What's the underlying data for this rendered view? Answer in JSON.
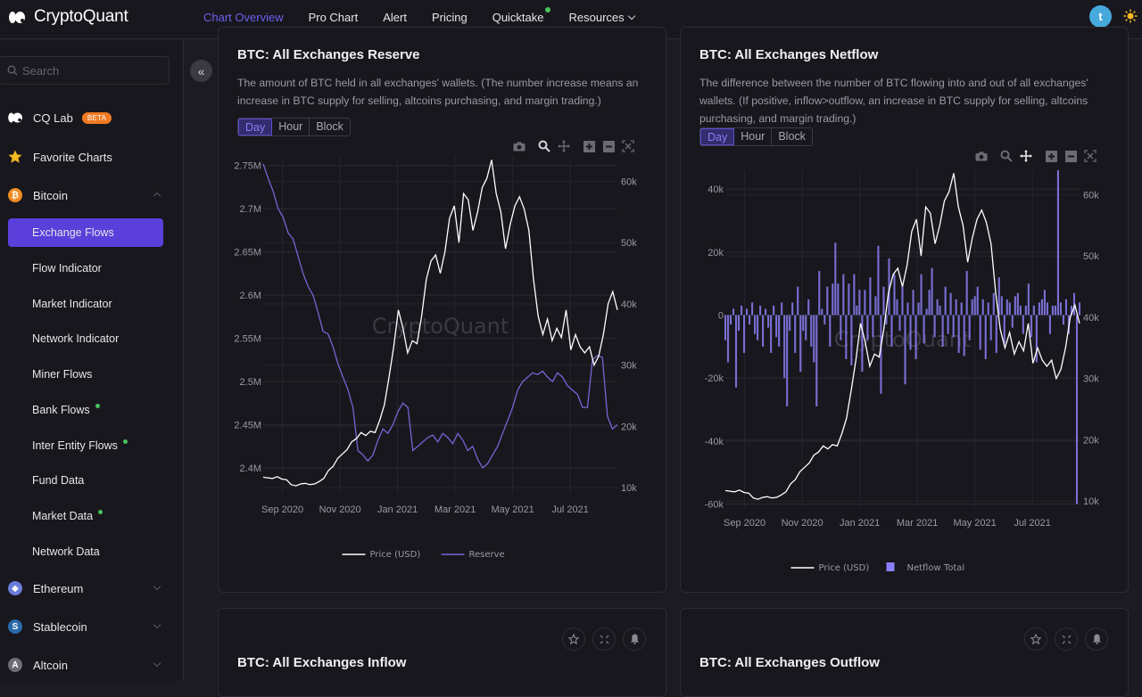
{
  "app": {
    "name": "CryptoQuant"
  },
  "nav": {
    "items": [
      {
        "label": "Chart Overview",
        "active": true
      },
      {
        "label": "Pro Chart"
      },
      {
        "label": "Alert"
      },
      {
        "label": "Pricing"
      },
      {
        "label": "Quicktake",
        "dot": true
      },
      {
        "label": "Resources",
        "dropdown": true
      }
    ],
    "avatar_letter": "t"
  },
  "sidebar": {
    "search_placeholder": "Search",
    "cq_lab": "CQ Lab",
    "beta": "BETA",
    "favorite": "Favorite Charts",
    "bitcoin": "Bitcoin",
    "sub_items": [
      {
        "label": "Exchange Flows",
        "active": true
      },
      {
        "label": "Flow Indicator"
      },
      {
        "label": "Market Indicator"
      },
      {
        "label": "Network Indicator"
      },
      {
        "label": "Miner Flows"
      },
      {
        "label": "Bank Flows",
        "dot": true
      },
      {
        "label": "Inter Entity Flows",
        "dot": true
      },
      {
        "label": "Fund Data"
      },
      {
        "label": "Market Data",
        "dot": true
      },
      {
        "label": "Network Data"
      }
    ],
    "ethereum": "Ethereum",
    "stablecoin": "Stablecoin",
    "altcoin": "Altcoin"
  },
  "colors": {
    "accent": "#5a3fdb",
    "reserve_line": "#7566d6",
    "netflow_bar": "#8b7ff5",
    "price_line": "#ffffff",
    "beta_badge": "#f07a22",
    "online_dot": "#4ac25a"
  },
  "period_options": [
    "Day",
    "Hour",
    "Block"
  ],
  "cards": {
    "reserve": {
      "title": "BTC: All Exchanges Reserve",
      "desc": "The amount of BTC held in all exchanges' wallets. (The number increase means an increase in BTC supply for selling, altcoins purchasing, and margin trading.)",
      "selected_period": "Day"
    },
    "netflow": {
      "title": "BTC: All Exchanges Netflow",
      "desc": "The difference between the number of BTC flowing into and out of all exchanges' wallets. (If positive, inflow>outflow, an increase in BTC supply for selling, altcoins purchasing, and margin trading.)",
      "selected_period": "Day"
    },
    "inflow": {
      "title": "BTC: All Exchanges Inflow"
    },
    "outflow": {
      "title": "BTC: All Exchanges Outflow"
    }
  },
  "watermark": "CryptoQuant",
  "chart_data": [
    {
      "type": "line",
      "title": "BTC: All Exchanges Reserve",
      "x_ticks": [
        "Sep 2020",
        "Nov 2020",
        "Jan 2021",
        "Mar 2021",
        "May 2021",
        "Jul 2021"
      ],
      "y_left_ticks": [
        "2.4M",
        "2.45M",
        "2.5M",
        "2.55M",
        "2.6M",
        "2.65M",
        "2.7M",
        "2.75M"
      ],
      "y_left_range": [
        2370000,
        2760000
      ],
      "y_right_ticks": [
        "10k",
        "20k",
        "30k",
        "40k",
        "50k",
        "60k"
      ],
      "y_right_range": [
        9000,
        64000
      ],
      "legend": [
        "Price (USD)",
        "Reserve"
      ],
      "legend_position": "bottom",
      "series": [
        {
          "name": "Reserve",
          "axis": "left",
          "values": [
            2752000,
            2735000,
            2720000,
            2700000,
            2690000,
            2672000,
            2665000,
            2645000,
            2625000,
            2610000,
            2600000,
            2580000,
            2558000,
            2555000,
            2540000,
            2520000,
            2505000,
            2490000,
            2470000,
            2420000,
            2415000,
            2408000,
            2415000,
            2432000,
            2445000,
            2440000,
            2450000,
            2465000,
            2475000,
            2470000,
            2420000,
            2425000,
            2430000,
            2435000,
            2438000,
            2430000,
            2440000,
            2435000,
            2428000,
            2440000,
            2432000,
            2420000,
            2425000,
            2410000,
            2400000,
            2405000,
            2415000,
            2425000,
            2440000,
            2455000,
            2470000,
            2490000,
            2500000,
            2505000,
            2510000,
            2508000,
            2512000,
            2505000,
            2500000,
            2510000,
            2505000,
            2495000,
            2490000,
            2485000,
            2470000,
            2470000,
            2525000,
            2530000,
            2528000,
            2460000,
            2445000,
            2450000
          ]
        },
        {
          "name": "Price (USD)",
          "axis": "right",
          "values": [
            11700,
            11600,
            11500,
            11800,
            11400,
            11300,
            10500,
            10300,
            10600,
            10700,
            10500,
            10600,
            11000,
            11500,
            12800,
            13500,
            14800,
            15500,
            16200,
            17500,
            18000,
            19000,
            18500,
            19200,
            19000,
            21000,
            23500,
            28000,
            33000,
            39000,
            36000,
            32000,
            34000,
            33500,
            38000,
            44000,
            47000,
            48000,
            45000,
            48500,
            54000,
            56000,
            50000,
            58000,
            57000,
            52000,
            55000,
            59000,
            60500,
            63500,
            58000,
            55000,
            49000,
            53000,
            56000,
            57500,
            55500,
            52000,
            44000,
            38000,
            35000,
            37500,
            34000,
            36000,
            34500,
            39000,
            32500,
            35000,
            33000,
            32000,
            33000,
            30000,
            31500,
            35000,
            40000,
            42000,
            39000
          ]
        }
      ]
    },
    {
      "type": "bar",
      "title": "BTC: All Exchanges Netflow",
      "x_ticks": [
        "Sep 2020",
        "Nov 2020",
        "Jan 2021",
        "Mar 2021",
        "May 2021",
        "Jul 2021"
      ],
      "y_left_ticks": [
        "-60k",
        "-40k",
        "-20k",
        "0",
        "20k",
        "40k"
      ],
      "y_left_range": [
        -61000,
        46000
      ],
      "y_right_ticks": [
        "10k",
        "20k",
        "30k",
        "40k",
        "50k",
        "60k"
      ],
      "y_right_range": [
        9000,
        64000
      ],
      "legend": [
        "Price (USD)",
        "Netflow Total"
      ],
      "legend_position": "bottom",
      "series": [
        {
          "name": "Netflow Total",
          "axis": "left",
          "type": "bar",
          "values": [
            -8000,
            -15000,
            -3000,
            2000,
            -23000,
            -5000,
            3000,
            -12000,
            2000,
            -3000,
            4000,
            -6000,
            -8000,
            3000,
            -10000,
            2000,
            -4000,
            -12000,
            3000,
            -7000,
            -10000,
            4000,
            -20000,
            -29000,
            -5000,
            4000,
            -12000,
            9000,
            -18000,
            -5000,
            -8000,
            5000,
            -10000,
            -15000,
            -29000,
            14000,
            2000,
            -3000,
            9000,
            -10000,
            10000,
            23000,
            10000,
            -8000,
            13000,
            -14000,
            10000,
            -16000,
            13000,
            3000,
            8000,
            -18000,
            8000,
            -8000,
            12000,
            -7000,
            6000,
            22000,
            -25000,
            9000,
            -3000,
            18000,
            -10000,
            13000,
            5000,
            -5000,
            9000,
            -22000,
            4000,
            -11000,
            8000,
            -14000,
            4000,
            13000,
            -9000,
            2000,
            8000,
            15000,
            -7000,
            5000,
            3000,
            -10000,
            9000,
            -6000,
            7000,
            -7000,
            5000,
            -12000,
            4000,
            -13000,
            14000,
            -8000,
            5000,
            6000,
            9000,
            -11000,
            5000,
            -14000,
            4000,
            -8000,
            7000,
            -12000,
            12000,
            6000,
            -9000,
            5000,
            4000,
            -4000,
            6000,
            7000,
            3000,
            -6000,
            3000,
            10000,
            -7000,
            3000,
            -15000,
            4000,
            5000,
            8000,
            4000,
            -6000,
            3000,
            3000,
            46000,
            4000,
            -3000,
            5000,
            -6000,
            3000,
            7000,
            -60000,
            4000
          ]
        },
        {
          "name": "Price (USD)",
          "axis": "right",
          "type": "line",
          "values": [
            11700,
            11600,
            11500,
            11800,
            11400,
            11300,
            10500,
            10300,
            10600,
            10700,
            10500,
            10600,
            11000,
            11500,
            12800,
            13500,
            14800,
            15500,
            16200,
            17500,
            18000,
            19000,
            18500,
            19200,
            19000,
            21000,
            23500,
            28000,
            33000,
            39000,
            36000,
            32000,
            34000,
            33500,
            38000,
            44000,
            47000,
            48000,
            45000,
            48500,
            54000,
            56000,
            50000,
            58000,
            57000,
            52000,
            55000,
            59000,
            60500,
            63500,
            58000,
            55000,
            49000,
            53000,
            56000,
            57500,
            55500,
            52000,
            44000,
            38000,
            35000,
            37500,
            34000,
            36000,
            34500,
            39000,
            32500,
            35000,
            33000,
            32000,
            33000,
            30000,
            31500,
            35000,
            40000,
            42000,
            39000
          ]
        }
      ]
    }
  ]
}
